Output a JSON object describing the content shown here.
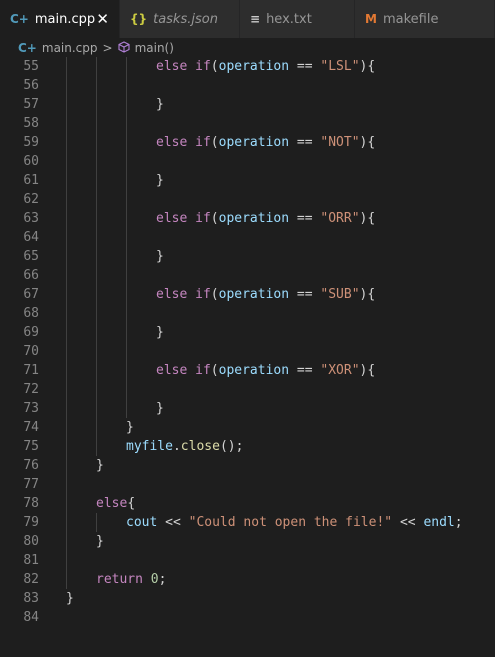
{
  "tabs": [
    {
      "label": "main.cpp",
      "icon": "C+",
      "icon_color": "#519aba",
      "active": true,
      "close": "✕"
    },
    {
      "label": "tasks.json",
      "icon": "{}",
      "icon_color": "#cbcb41",
      "active": false
    },
    {
      "label": "hex.txt",
      "icon": "≡",
      "icon_color": "#cccccc",
      "active": false
    },
    {
      "label": "makefile",
      "icon": "M",
      "icon_color": "#e37933",
      "active": false
    }
  ],
  "breadcrumb": {
    "file": "main.cpp",
    "file_icon": "C+",
    "separator": ">",
    "symbol": "main()",
    "symbol_icon": "cube"
  },
  "lines": [
    {
      "n": "55",
      "i": 3,
      "t": [
        [
          "kw",
          "else"
        ],
        [
          "op",
          " "
        ],
        [
          "kw",
          "if"
        ],
        [
          "op",
          "("
        ],
        [
          "var",
          "operation"
        ],
        [
          "op",
          " == "
        ],
        [
          "str",
          "\"LSL\""
        ],
        [
          "op",
          "){"
        ]
      ]
    },
    {
      "n": "56",
      "i": 3,
      "t": []
    },
    {
      "n": "57",
      "i": 3,
      "t": [
        [
          "op",
          "}"
        ]
      ]
    },
    {
      "n": "58",
      "i": 3,
      "t": []
    },
    {
      "n": "59",
      "i": 3,
      "t": [
        [
          "kw",
          "else"
        ],
        [
          "op",
          " "
        ],
        [
          "kw",
          "if"
        ],
        [
          "op",
          "("
        ],
        [
          "var",
          "operation"
        ],
        [
          "op",
          " == "
        ],
        [
          "str",
          "\"NOT\""
        ],
        [
          "op",
          "){"
        ]
      ]
    },
    {
      "n": "60",
      "i": 3,
      "t": []
    },
    {
      "n": "61",
      "i": 3,
      "t": [
        [
          "op",
          "}"
        ]
      ]
    },
    {
      "n": "62",
      "i": 3,
      "t": []
    },
    {
      "n": "63",
      "i": 3,
      "t": [
        [
          "kw",
          "else"
        ],
        [
          "op",
          " "
        ],
        [
          "kw",
          "if"
        ],
        [
          "op",
          "("
        ],
        [
          "var",
          "operation"
        ],
        [
          "op",
          " == "
        ],
        [
          "str",
          "\"ORR\""
        ],
        [
          "op",
          "){"
        ]
      ]
    },
    {
      "n": "64",
      "i": 3,
      "t": []
    },
    {
      "n": "65",
      "i": 3,
      "t": [
        [
          "op",
          "}"
        ]
      ]
    },
    {
      "n": "66",
      "i": 3,
      "t": []
    },
    {
      "n": "67",
      "i": 3,
      "t": [
        [
          "kw",
          "else"
        ],
        [
          "op",
          " "
        ],
        [
          "kw",
          "if"
        ],
        [
          "op",
          "("
        ],
        [
          "var",
          "operation"
        ],
        [
          "op",
          " == "
        ],
        [
          "str",
          "\"SUB\""
        ],
        [
          "op",
          "){"
        ]
      ]
    },
    {
      "n": "68",
      "i": 3,
      "t": []
    },
    {
      "n": "69",
      "i": 3,
      "t": [
        [
          "op",
          "}"
        ]
      ]
    },
    {
      "n": "70",
      "i": 3,
      "t": []
    },
    {
      "n": "71",
      "i": 3,
      "t": [
        [
          "kw",
          "else"
        ],
        [
          "op",
          " "
        ],
        [
          "kw",
          "if"
        ],
        [
          "op",
          "("
        ],
        [
          "var",
          "operation"
        ],
        [
          "op",
          " == "
        ],
        [
          "str",
          "\"XOR\""
        ],
        [
          "op",
          "){"
        ]
      ]
    },
    {
      "n": "72",
      "i": 3,
      "t": []
    },
    {
      "n": "73",
      "i": 3,
      "t": [
        [
          "op",
          "}"
        ]
      ]
    },
    {
      "n": "74",
      "i": 2,
      "t": [
        [
          "op",
          "}"
        ]
      ]
    },
    {
      "n": "75",
      "i": 2,
      "t": [
        [
          "var",
          "myfile"
        ],
        [
          "op",
          "."
        ],
        [
          "fn",
          "close"
        ],
        [
          "op",
          "();"
        ]
      ]
    },
    {
      "n": "76",
      "i": 1,
      "t": [
        [
          "op",
          "}"
        ]
      ]
    },
    {
      "n": "77",
      "i": 1,
      "t": []
    },
    {
      "n": "78",
      "i": 1,
      "t": [
        [
          "kw",
          "else"
        ],
        [
          "op",
          "{"
        ]
      ]
    },
    {
      "n": "79",
      "i": 2,
      "t": [
        [
          "var",
          "cout"
        ],
        [
          "op",
          " << "
        ],
        [
          "str",
          "\"Could not open the file!\""
        ],
        [
          "op",
          " << "
        ],
        [
          "var",
          "endl"
        ],
        [
          "op",
          ";"
        ]
      ]
    },
    {
      "n": "80",
      "i": 1,
      "t": [
        [
          "op",
          "}"
        ]
      ]
    },
    {
      "n": "81",
      "i": 1,
      "t": []
    },
    {
      "n": "82",
      "i": 1,
      "t": [
        [
          "kw",
          "return"
        ],
        [
          "op",
          " "
        ],
        [
          "num",
          "0"
        ],
        [
          "op",
          ";"
        ]
      ]
    },
    {
      "n": "83",
      "i": 0,
      "t": [
        [
          "op",
          "}"
        ]
      ]
    },
    {
      "n": "84",
      "i": 0,
      "t": []
    }
  ]
}
